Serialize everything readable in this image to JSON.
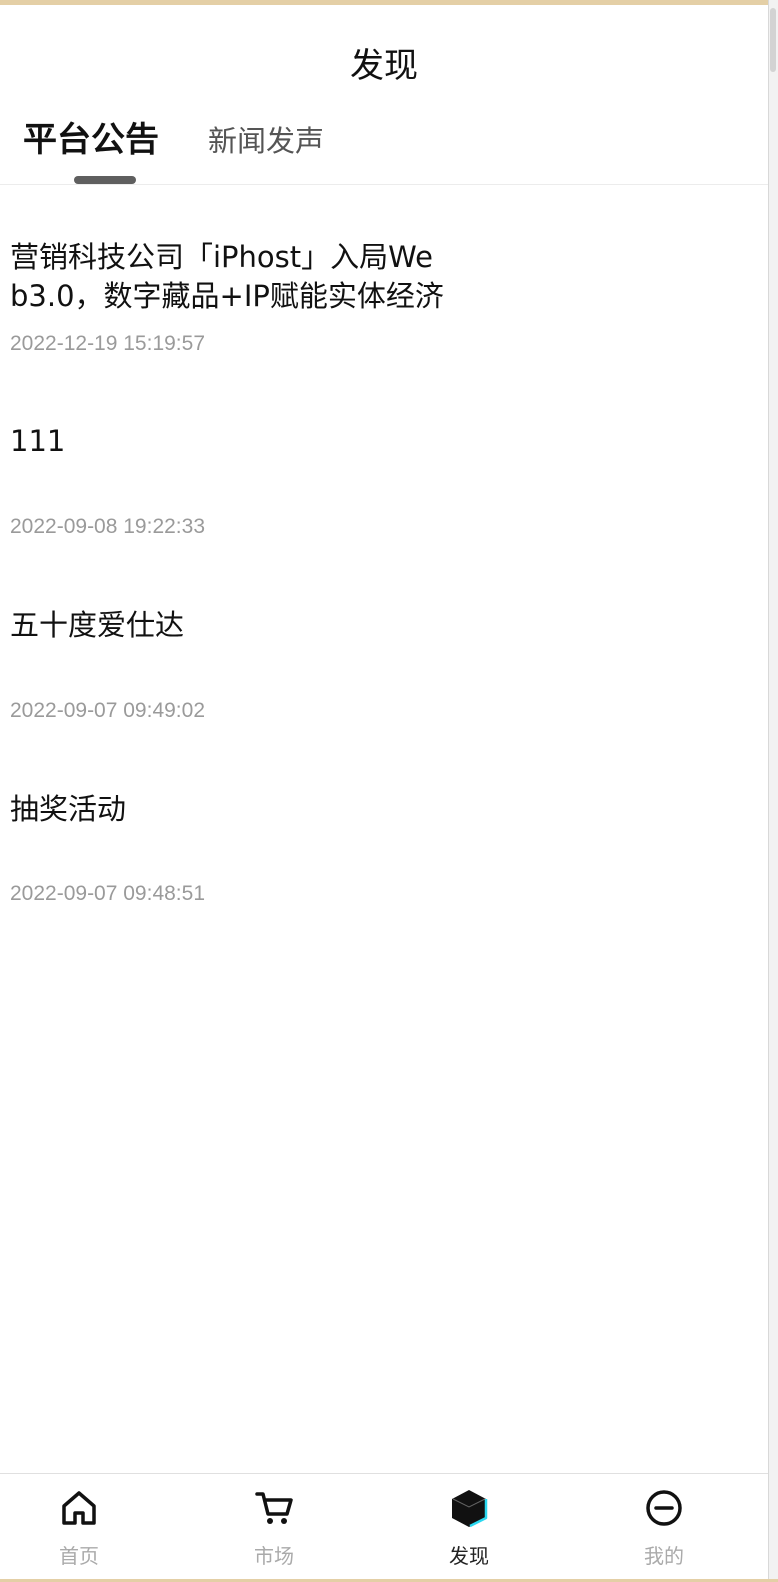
{
  "header": {
    "title": "发现"
  },
  "tabs": [
    {
      "label": "平台公告",
      "active": true
    },
    {
      "label": "新闻发声",
      "active": false
    }
  ],
  "announcements": [
    {
      "title": "营销科技公司「iPhost」入局Web3.0，数字藏品+IP赋能实体经济",
      "date": "2022-12-19 15:19:57"
    },
    {
      "title": "111",
      "date": "2022-09-08 19:22:33"
    },
    {
      "title": "五十度爱仕达",
      "date": "2022-09-07 09:49:02"
    },
    {
      "title": "抽奖活动",
      "date": "2022-09-07 09:48:51"
    }
  ],
  "bottom_nav": [
    {
      "label": "首页",
      "icon": "home-icon",
      "active": false
    },
    {
      "label": "市场",
      "icon": "cart-icon",
      "active": false
    },
    {
      "label": "发现",
      "icon": "cube-icon",
      "active": true
    },
    {
      "label": "我的",
      "icon": "user-circle-icon",
      "active": false
    }
  ],
  "colors": {
    "accent_cyan": "#2ad8f0",
    "top_rule": "#e4cfa6",
    "text_primary": "#111111",
    "text_muted": "#9a9a9a",
    "nav_inactive": "#aaaaaa"
  }
}
